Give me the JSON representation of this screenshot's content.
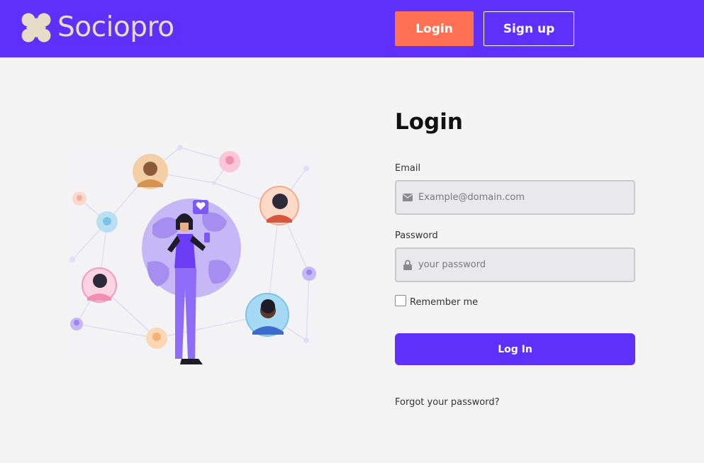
{
  "brand": {
    "name": "Sociopro",
    "logo_color": "#e6dcc8",
    "icon": "four-petal-logo-icon"
  },
  "colors": {
    "primary": "#5f30fa",
    "accent": "#ff7152",
    "background": "#f4f4f5"
  },
  "nav": {
    "login_label": "Login",
    "signup_label": "Sign up"
  },
  "form": {
    "title": "Login",
    "email_label": "Email",
    "email_placeholder": "Example@domain.com",
    "email_icon": "envelope-icon",
    "password_label": "Password",
    "password_placeholder": "your password",
    "password_icon": "lock-icon",
    "remember_label": "Remember me",
    "remember_checked": false,
    "submit_label": "Log In",
    "forgot_label": "Forgot your password?"
  }
}
